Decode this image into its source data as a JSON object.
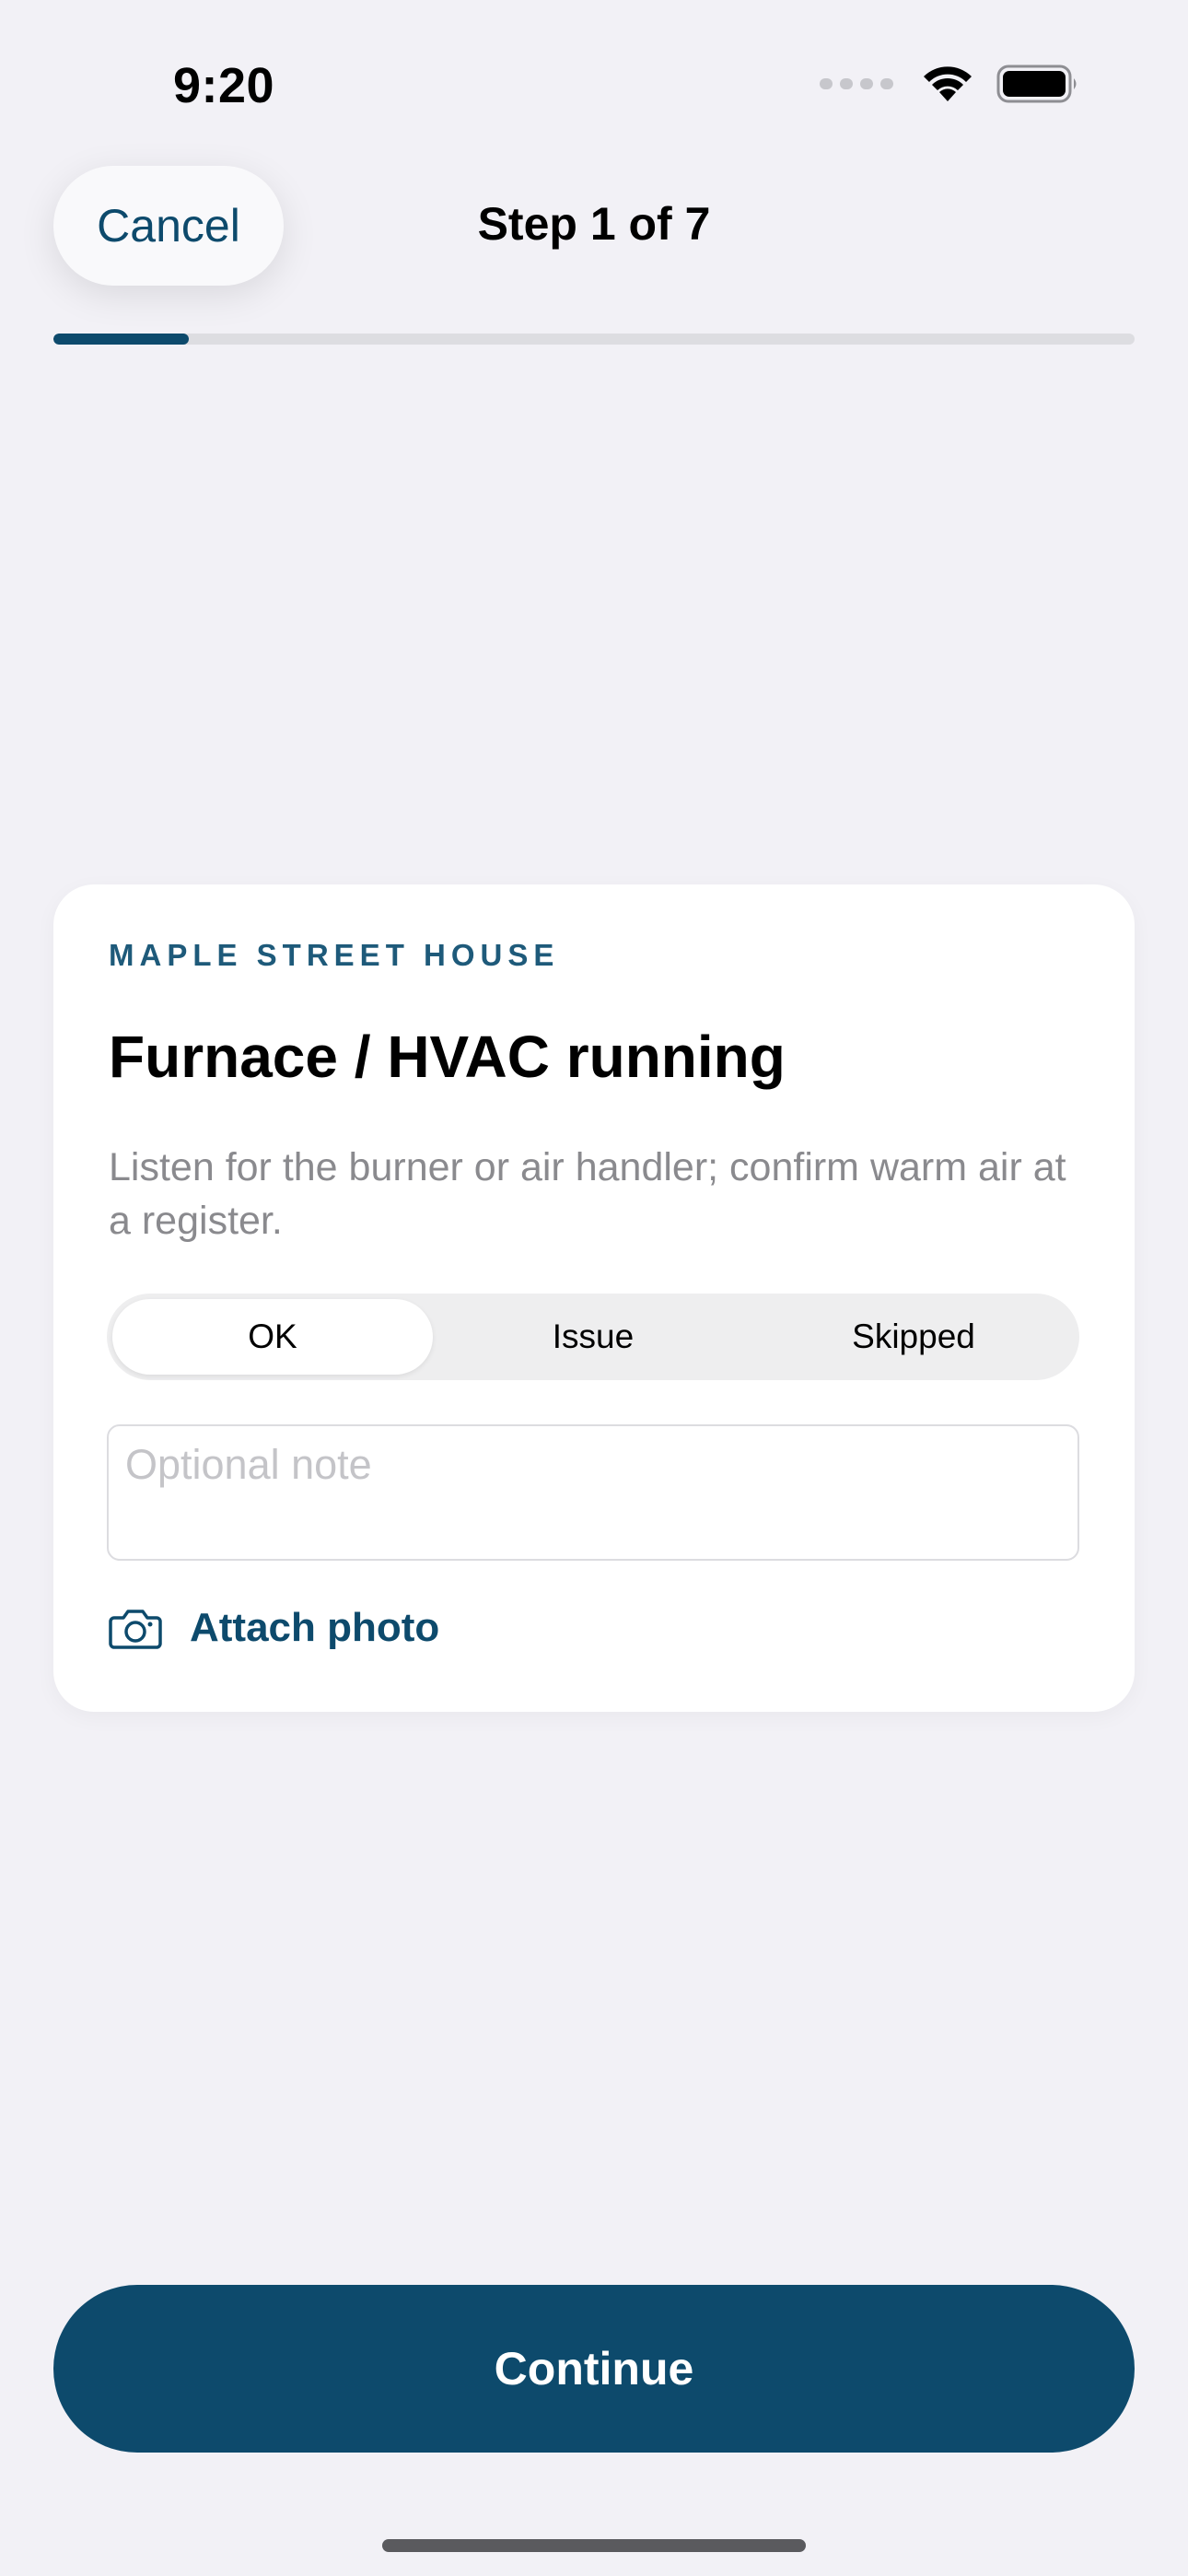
{
  "status_bar": {
    "time": "9:20",
    "icons": [
      "signal-icon",
      "wifi-icon",
      "battery-icon"
    ]
  },
  "nav": {
    "cancel_label": "Cancel",
    "title": "Step 1 of 7"
  },
  "progress": {
    "current": 1,
    "total": 7,
    "fill_fraction": 0.125
  },
  "card": {
    "eyebrow": "MAPLE STREET HOUSE",
    "title": "Furnace / HVAC running",
    "description": "Listen for the burner or air handler; confirm warm air at a register.",
    "segments": [
      {
        "label": "OK",
        "selected": true
      },
      {
        "label": "Issue",
        "selected": false
      },
      {
        "label": "Skipped",
        "selected": false
      }
    ],
    "note_placeholder": "Optional note",
    "note_value": "",
    "attach_label": "Attach photo"
  },
  "footer": {
    "continue_label": "Continue"
  },
  "colors": {
    "accent": "#0D4A6C",
    "background": "#F2F1F6",
    "card": "#FFFFFF",
    "muted_text": "#8A8A8E"
  }
}
